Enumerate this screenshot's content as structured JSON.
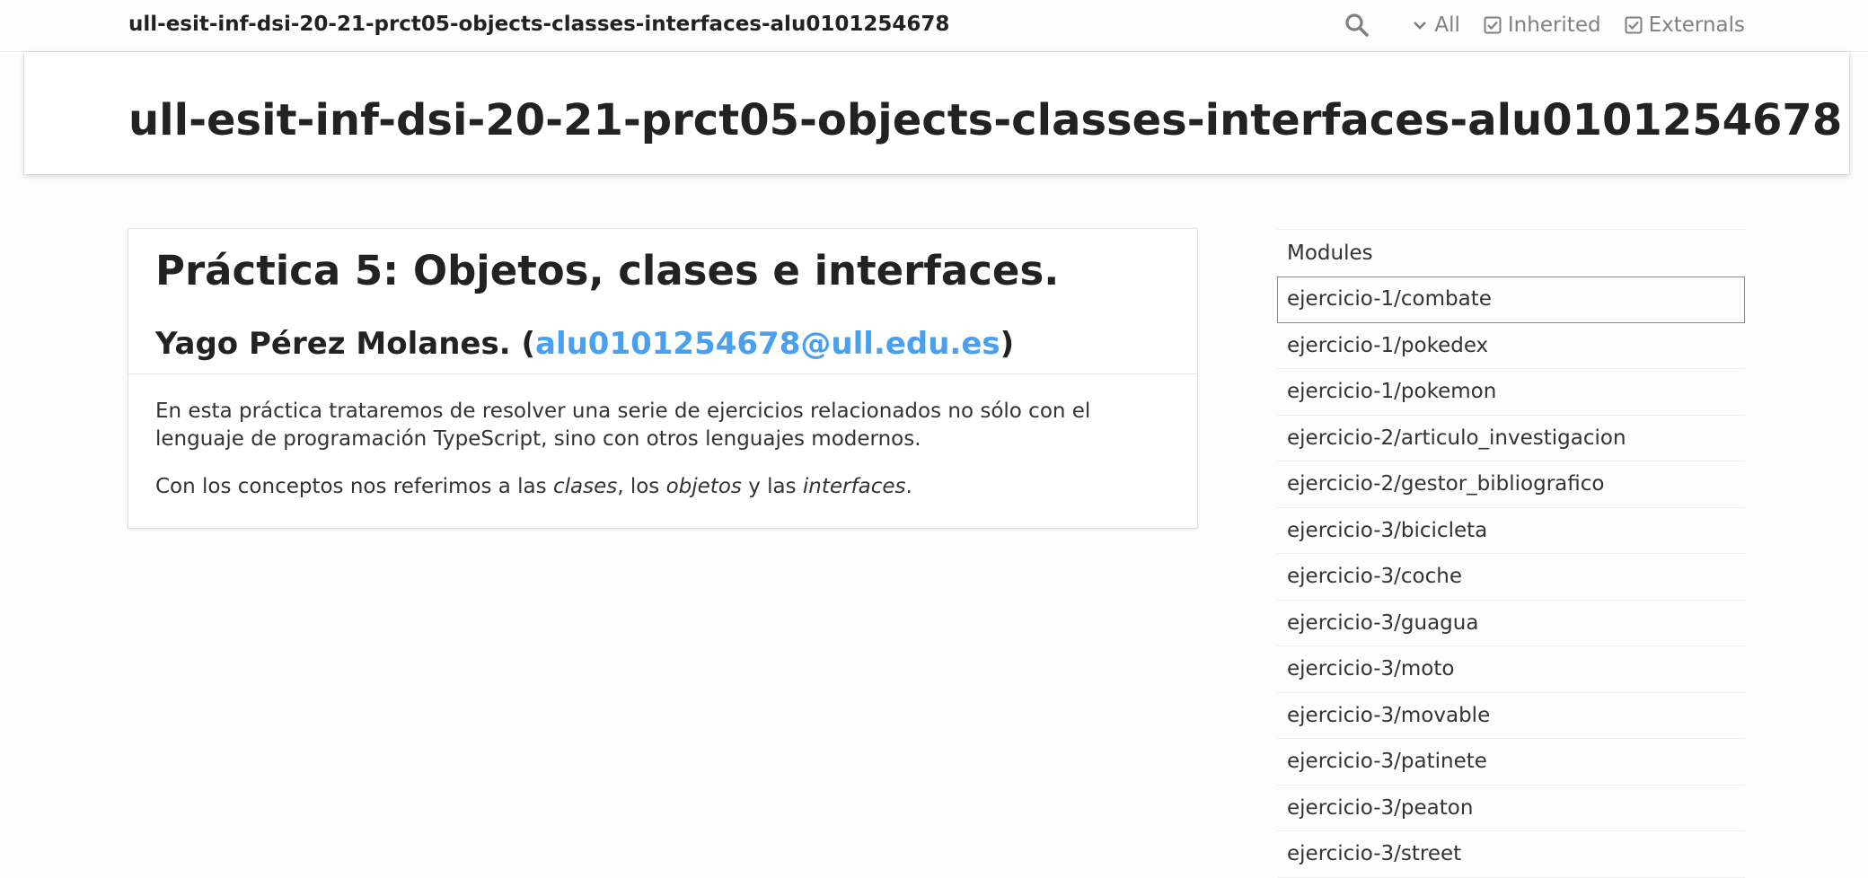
{
  "toolbar": {
    "title": "ull-esit-inf-dsi-20-21-prct05-objects-classes-interfaces-alu0101254678",
    "filter_all": "All",
    "filter_inherited": "Inherited",
    "filter_externals": "Externals",
    "icons": [
      "search-icon",
      "chevron-down-icon",
      "checkbox-checked-icon",
      "checkbox-checked-icon"
    ]
  },
  "header": {
    "title": "ull-esit-inf-dsi-20-21-prct05-objects-classes-interfaces-alu0101254678"
  },
  "readme": {
    "h1": "Práctica 5: Objetos, clases e interfaces.",
    "author_prefix": "Yago Pérez Molanes. (",
    "author_email": "alu0101254678@ull.edu.es",
    "author_suffix": ")",
    "p1": "En esta práctica trataremos de resolver una serie de ejercicios relacionados no sólo con el lenguaje de programación TypeScript, sino con otros lenguajes modernos.",
    "p2_part1": "Con los conceptos nos referimos a las ",
    "p2_em1": "clases",
    "p2_part2": ", los ",
    "p2_em2": "objetos",
    "p2_part3": " y las ",
    "p2_em3": "interfaces",
    "p2_part4": "."
  },
  "sidebar": {
    "heading": "Modules",
    "items": [
      {
        "label": "ejercicio-1/combate"
      },
      {
        "label": "ejercicio-1/pokedex"
      },
      {
        "label": "ejercicio-1/pokemon"
      },
      {
        "label": "ejercicio-2/articulo_investigacion"
      },
      {
        "label": "ejercicio-2/gestor_bibliografico"
      },
      {
        "label": "ejercicio-3/bicicleta"
      },
      {
        "label": "ejercicio-3/coche"
      },
      {
        "label": "ejercicio-3/guagua"
      },
      {
        "label": "ejercicio-3/moto"
      },
      {
        "label": "ejercicio-3/movable"
      },
      {
        "label": "ejercicio-3/patinete"
      },
      {
        "label": "ejercicio-3/peaton"
      },
      {
        "label": "ejercicio-3/street"
      }
    ]
  },
  "colors": {
    "link": "#4aa0f0",
    "text": "#222222",
    "muted": "#808080"
  }
}
